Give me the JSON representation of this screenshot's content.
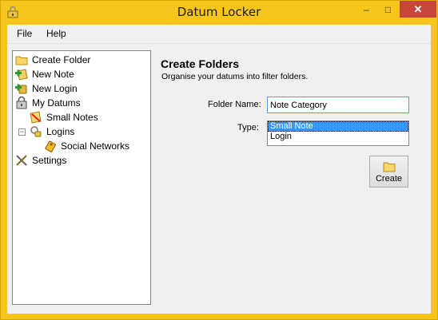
{
  "window": {
    "title": "Datum Locker",
    "controls": {
      "minimize": "–",
      "maximize": "□",
      "close": "✕"
    }
  },
  "menu": {
    "file": "File",
    "help": "Help"
  },
  "tree": {
    "items": [
      {
        "label": "Create Folder",
        "icon": "folder-icon"
      },
      {
        "label": "New Note",
        "icon": "add-note-icon"
      },
      {
        "label": "New Login",
        "icon": "add-login-icon"
      },
      {
        "label": "My Datums",
        "icon": "vault-icon"
      },
      {
        "label": "Small Notes",
        "icon": "note-icon"
      },
      {
        "label": "Logins",
        "icon": "key-ring-icon",
        "expander": "−"
      },
      {
        "label": "Social Networks",
        "icon": "key-icon"
      },
      {
        "label": "Settings",
        "icon": "tools-icon"
      }
    ]
  },
  "form": {
    "heading": "Create Folders",
    "subheading": "Organise your datums into filter folders.",
    "folder_name_label": "Folder Name:",
    "folder_name_value": "Note Category",
    "type_label": "Type:",
    "type_options": [
      "Small Note",
      "Login"
    ],
    "type_selected": "Small Note",
    "create_label": "Create"
  },
  "colors": {
    "frame": "#f5c51a",
    "close": "#c7453b",
    "selection": "#3399ff",
    "focus_border": "#569de5"
  }
}
